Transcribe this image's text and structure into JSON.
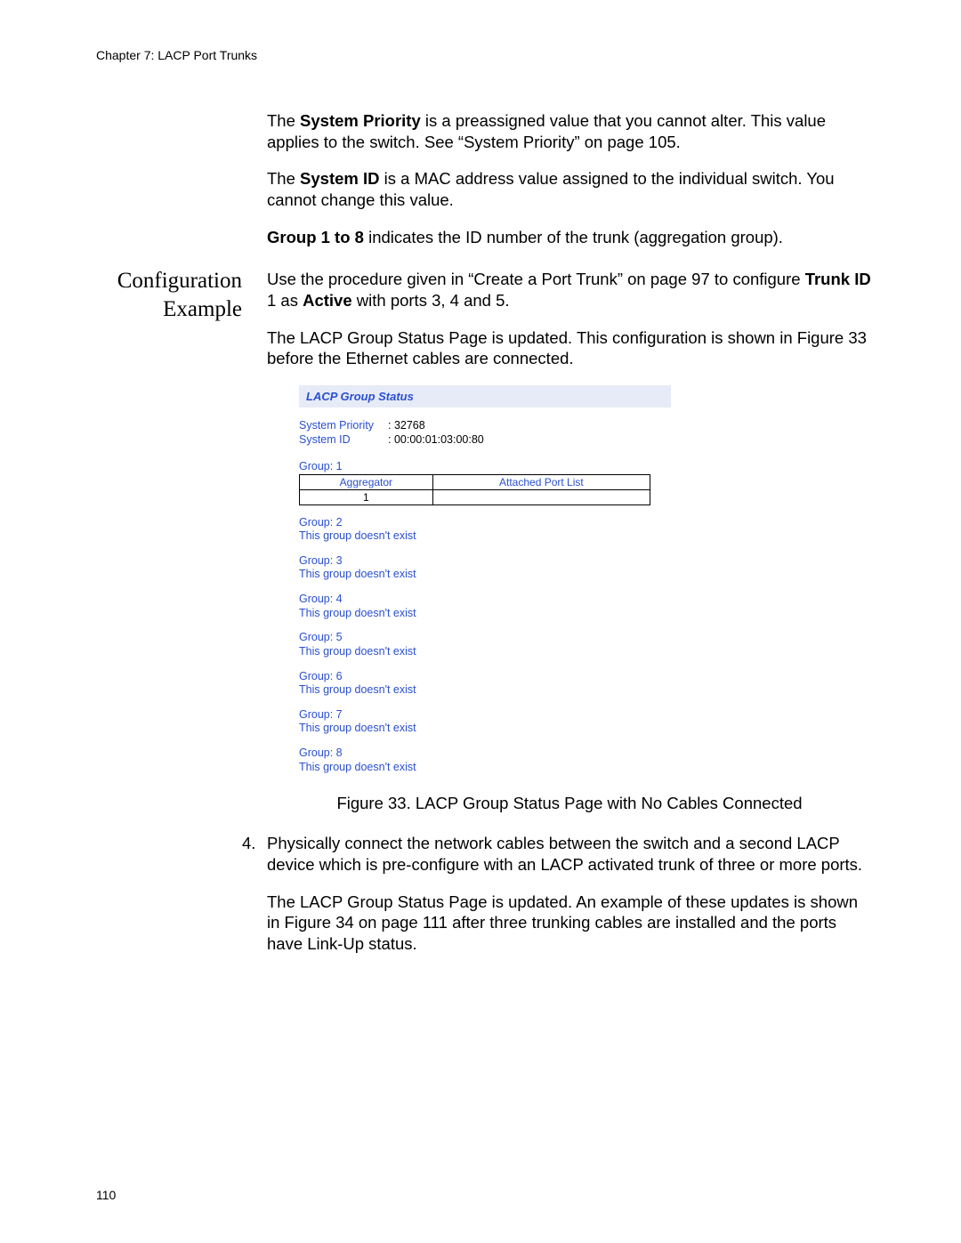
{
  "header": {
    "chapter": "Chapter 7: LACP Port Trunks",
    "pageNumber": "110"
  },
  "intro": {
    "p1_pre": "The ",
    "p1_bold": "System Priority",
    "p1_post": " is a preassigned value that you cannot alter. This value applies to the switch. See “System Priority” on page 105.",
    "p2_pre": "The ",
    "p2_bold": "System ID",
    "p2_post": " is a MAC address value assigned to the individual switch. You cannot change this value.",
    "p3_bold": "Group 1 to 8",
    "p3_post": " indicates the ID number of the trunk (aggregation group)."
  },
  "sideHeading": "Configuration Example",
  "config": {
    "p1_a": "Use the procedure given in “Create a Port Trunk” on page 97 to configure ",
    "p1_bold1": "Trunk ID",
    "p1_b": " 1 as ",
    "p1_bold2": "Active",
    "p1_c": " with ports 3, 4 and 5.",
    "p2": "The LACP Group Status Page is updated. This configuration is shown in Figure 33 before the Ethernet cables are connected."
  },
  "lacp": {
    "title": "LACP Group Status",
    "sysPriorityLabel": "System Priority",
    "sysPriorityValue": ": 32768",
    "sysIdLabel": "System ID",
    "sysIdValue": ": 00:00:01:03:00:80",
    "group1Label": "Group: 1",
    "table": {
      "h1": "Aggregator",
      "h2": "Attached Port List",
      "r1c1": "1",
      "r1c2": ""
    },
    "groups": [
      {
        "label": "Group: 2",
        "msg": "This group doesn't exist"
      },
      {
        "label": "Group: 3",
        "msg": "This group doesn't exist"
      },
      {
        "label": "Group: 4",
        "msg": "This group doesn't exist"
      },
      {
        "label": "Group: 5",
        "msg": "This group doesn't exist"
      },
      {
        "label": "Group: 6",
        "msg": "This group doesn't exist"
      },
      {
        "label": "Group: 7",
        "msg": "This group doesn't exist"
      },
      {
        "label": "Group: 8",
        "msg": "This group doesn't exist"
      }
    ]
  },
  "figureCaption": "Figure 33. LACP Group Status Page with No Cables Connected",
  "step4": {
    "num": "4.",
    "text": "Physically connect the network cables between the switch and a second LACP device which is pre-configure with an LACP activated trunk of three or more ports."
  },
  "afterStep": "The LACP Group Status Page is updated. An example of these updates is shown in Figure 34 on page 111 after three trunking cables are installed and the ports have Link-Up status."
}
